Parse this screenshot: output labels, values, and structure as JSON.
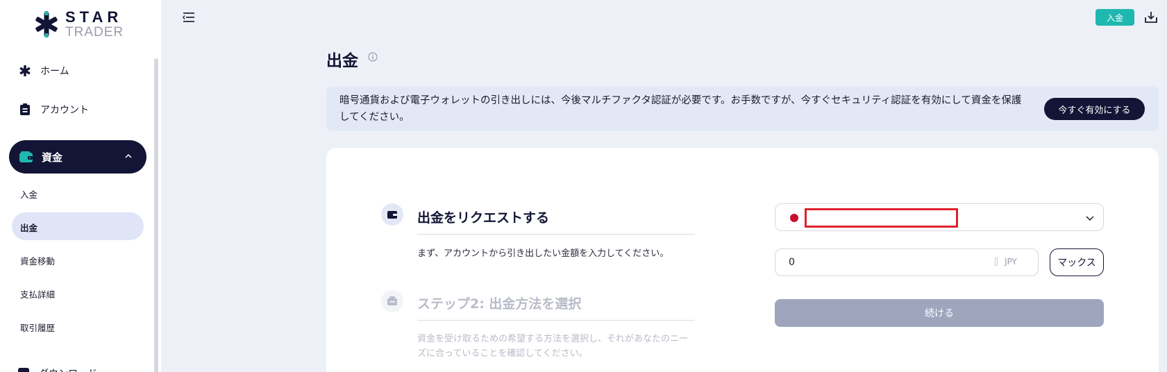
{
  "brand": {
    "line1": "STAR",
    "line2": "TRADER"
  },
  "sidebar": {
    "home": "ホーム",
    "account": "アカウント",
    "funds": "資金",
    "sub_items": [
      "入金",
      "出金",
      "資金移動",
      "支払詳細",
      "取引履歴"
    ],
    "active_sub": "出金",
    "download": "ダウンロード"
  },
  "topbar": {
    "deposit_label": "入金"
  },
  "page": {
    "title": "出金"
  },
  "banner": {
    "text": "暗号通貨および電子ウォレットの引き出しには、今後マルチファクタ認証が必要です。お手数ですが、今すぐセキュリティ認証を有効にして資金を保護してください。",
    "button": "今すぐ有効にする"
  },
  "steps": [
    {
      "title": "出金をリクエストする",
      "description": "まず、アカウントから引き出したい金額を入力してください。",
      "active": true
    },
    {
      "title": "ステップ2:  出金方法を選択",
      "description": "資金を受け取るための希望する方法を選択し、それがあなたのニーズに合っていることを確認してください。",
      "active": false
    }
  ],
  "form": {
    "amount_value": "0",
    "currency_unit": "JPY",
    "max_label": "マックス",
    "continue_label": "続ける"
  },
  "colors": {
    "navy": "#121535",
    "teal": "#1fb8b0",
    "page_bg": "#eef0f8",
    "banner_bg": "#e3e8f6",
    "disabled_button": "#9ea5bd",
    "redaction": "#e0212b",
    "flag_red": "#c8102e"
  },
  "icons": [
    "star-logo-icon",
    "home-star-icon",
    "clipboard-icon",
    "wallet-icon",
    "chevron-up-icon",
    "sidebar-toggle-icon",
    "download-icon",
    "info-icon",
    "step-wallet-icon",
    "step-bank-icon",
    "chevron-down-icon"
  ]
}
